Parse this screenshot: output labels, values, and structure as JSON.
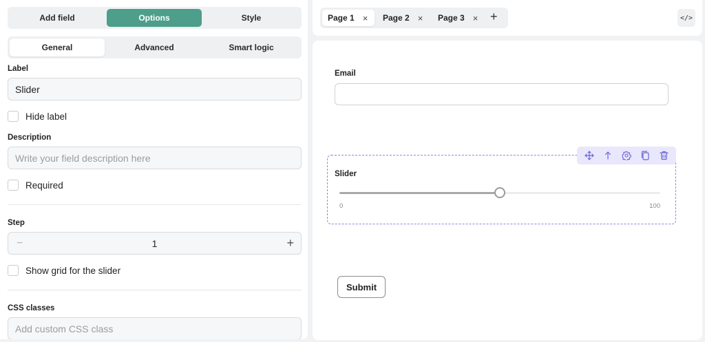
{
  "left_panel": {
    "main_tabs": [
      {
        "label": "Add field",
        "active": false
      },
      {
        "label": "Options",
        "active": true
      },
      {
        "label": "Style",
        "active": false
      }
    ],
    "sub_tabs": [
      {
        "label": "General",
        "active": true
      },
      {
        "label": "Advanced",
        "active": false
      },
      {
        "label": "Smart logic",
        "active": false
      }
    ],
    "label_field": {
      "label": "Label",
      "value": "Slider"
    },
    "hide_label": {
      "label": "Hide label",
      "checked": false
    },
    "description_field": {
      "label": "Description",
      "placeholder": "Write your field description here"
    },
    "required": {
      "label": "Required",
      "checked": false
    },
    "step_field": {
      "label": "Step",
      "value": "1",
      "minus": "−",
      "plus": "+"
    },
    "show_grid": {
      "label": "Show grid for the slider",
      "checked": false
    },
    "css_field": {
      "label": "CSS classes",
      "placeholder": "Add custom CSS class"
    }
  },
  "top_bar": {
    "pages": [
      {
        "label": "Page 1",
        "active": true,
        "close": "×"
      },
      {
        "label": "Page 2",
        "active": false,
        "close": "×"
      },
      {
        "label": "Page 3",
        "active": false,
        "close": "×"
      }
    ],
    "add_page": "+",
    "code_button": "</>"
  },
  "canvas": {
    "email": {
      "label": "Email",
      "value": ""
    },
    "slider": {
      "label": "Slider",
      "min": "0",
      "max": "100",
      "value": 50
    },
    "toolbar_icons": [
      "move-icon",
      "arrow-up-icon",
      "gear-icon",
      "copy-icon",
      "trash-icon"
    ],
    "submit_label": "Submit"
  },
  "colors": {
    "accent": "#4d9e8a",
    "selection": "#8c88e0",
    "toolbar_bg": "#e9e7fb",
    "toolbar_icon": "#6a64d8"
  }
}
